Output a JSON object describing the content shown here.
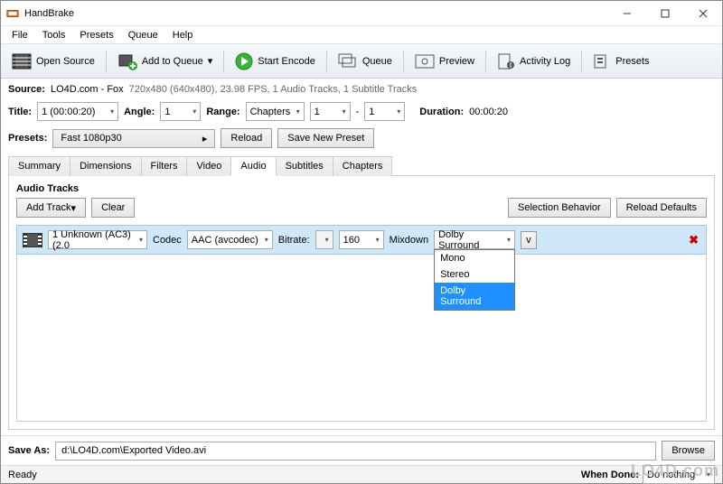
{
  "titlebar": {
    "app": "HandBrake"
  },
  "menubar": [
    "File",
    "Tools",
    "Presets",
    "Queue",
    "Help"
  ],
  "toolbar": {
    "open_source": "Open Source",
    "add_to_queue": "Add to Queue",
    "start_encode": "Start Encode",
    "queue": "Queue",
    "preview": "Preview",
    "activity_log": "Activity Log",
    "presets": "Presets"
  },
  "source": {
    "label": "Source:",
    "name": "LO4D.com - Fox",
    "info": "720x480 (640x480), 23.98 FPS, 1 Audio Tracks, 1 Subtitle Tracks"
  },
  "title_row": {
    "title_label": "Title:",
    "title_value": "1 (00:00:20)",
    "angle_label": "Angle:",
    "angle_value": "1",
    "range_label": "Range:",
    "range_mode": "Chapters",
    "range_from": "1",
    "range_to_sep": "-",
    "range_to": "1",
    "duration_label": "Duration:",
    "duration_value": "00:00:20"
  },
  "presets_row": {
    "label": "Presets:",
    "value": "Fast 1080p30",
    "reload": "Reload",
    "save_new": "Save New Preset"
  },
  "tabs": [
    "Summary",
    "Dimensions",
    "Filters",
    "Video",
    "Audio",
    "Subtitles",
    "Chapters"
  ],
  "active_tab": "Audio",
  "audio": {
    "section": "Audio Tracks",
    "add_track": "Add Track",
    "clear": "Clear",
    "selection_behavior": "Selection Behavior",
    "reload_defaults": "Reload Defaults",
    "track_source": "1 Unknown (AC3) (2.0",
    "codec_label": "Codec",
    "codec_value": "AAC (avcodec)",
    "bitrate_label": "Bitrate:",
    "bitrate_value": "160",
    "mixdown_label": "Mixdown",
    "mixdown_value": "Dolby Surround",
    "expand_btn": "v",
    "mixdown_options": [
      "Mono",
      "Stereo",
      "Dolby Surround"
    ]
  },
  "save": {
    "label": "Save As:",
    "path": "d:\\LO4D.com\\Exported Video.avi",
    "browse": "Browse"
  },
  "status": {
    "ready": "Ready",
    "when_done_label": "When Done:",
    "when_done_value": "Do nothing"
  },
  "watermark": "LO4D.com"
}
